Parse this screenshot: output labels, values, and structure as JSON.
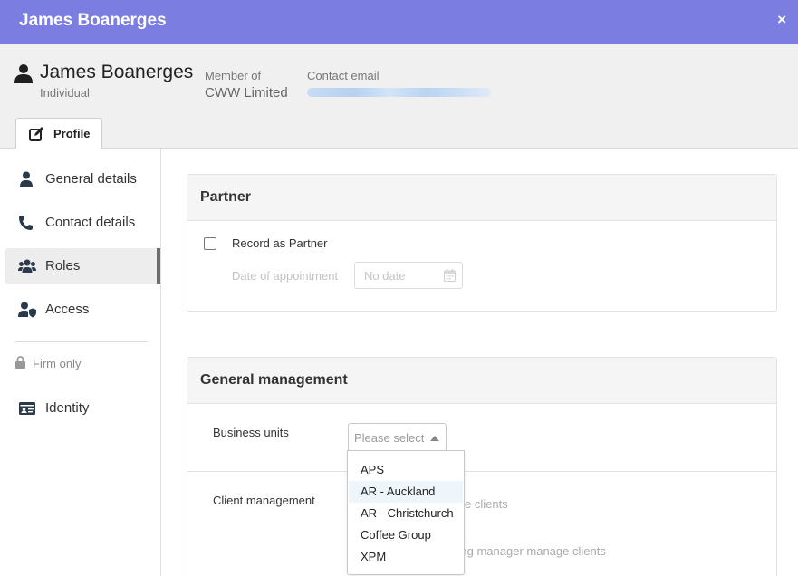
{
  "window": {
    "title": "James Boanerges",
    "close_label": "×"
  },
  "contact": {
    "name": "James Boanerges",
    "type": "Individual",
    "member_of_label": "Member of",
    "member_of_value": "CWW Limited",
    "email_label": "Contact email"
  },
  "tabs": [
    {
      "label": "Profile",
      "icon": "edit-icon"
    }
  ],
  "sidebar": {
    "items": [
      {
        "label": "General details",
        "icon": "user-icon"
      },
      {
        "label": "Contact details",
        "icon": "phone-icon"
      },
      {
        "label": "Roles",
        "icon": "users-icon",
        "active": true
      },
      {
        "label": "Access",
        "icon": "user-shield-icon"
      }
    ],
    "firm_only_label": "Firm only",
    "firm_items": [
      {
        "label": "Identity",
        "icon": "id-card-icon"
      }
    ]
  },
  "partner": {
    "title": "Partner",
    "record_label": "Record as Partner",
    "date_label": "Date of appointment",
    "date_placeholder": "No date"
  },
  "general_management": {
    "title": "General management",
    "business_units_label": "Business units",
    "select_placeholder": "Please select",
    "client_management_label": "Client management",
    "faded_text_1": "e clients",
    "faded_text_2": "ying manager manage clients"
  },
  "dropdown": {
    "options": [
      "APS",
      "AR - Auckland",
      "AR - Christchurch",
      "Coffee Group",
      "XPM"
    ],
    "highlighted": "AR - Auckland"
  },
  "colors": {
    "titlebar": "#7b7ee0",
    "header_bg": "#f0f0f0",
    "highlight": "#eef6fb"
  }
}
